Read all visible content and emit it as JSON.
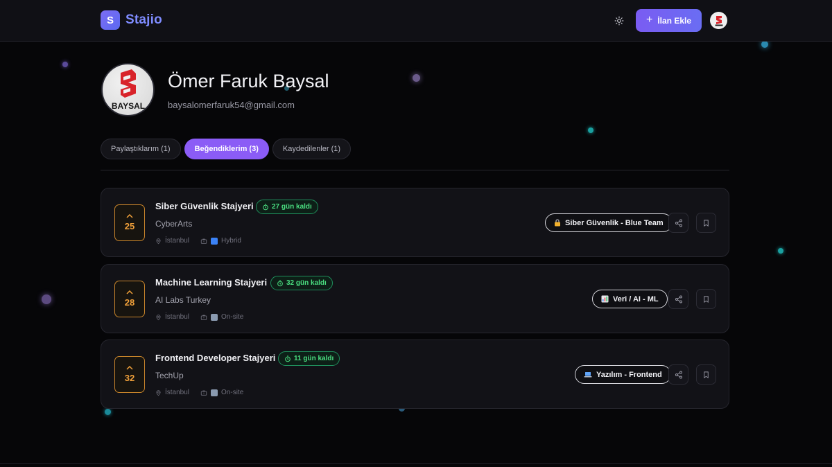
{
  "app": {
    "logo_letter": "S",
    "name": "Stajio"
  },
  "header": {
    "add_label": "İlan Ekle"
  },
  "profile": {
    "name": "Ömer Faruk Baysal",
    "email": "baysalomerfaruk54@gmail.com",
    "avatar_text": "BAYSAL"
  },
  "tabs": [
    {
      "label": "Paylaştıklarım (1)",
      "active": false
    },
    {
      "label": "Beğendiklerim (3)",
      "active": true
    },
    {
      "label": "Kaydedilenler (1)",
      "active": false
    }
  ],
  "listings": [
    {
      "votes": "25",
      "title": "Siber Güvenlik Stajyeri",
      "deadline": "27 gün kaldı",
      "company": "CyberArts",
      "location": "İstanbul",
      "work_type": "Hybrid",
      "category": "Siber Güvenlik - Blue Team",
      "category_icon": "lock-icon"
    },
    {
      "votes": "28",
      "title": "Machine Learning Stajyeri",
      "deadline": "32 gün kaldı",
      "company": "AI Labs Turkey",
      "location": "İstanbul",
      "work_type": "On-site",
      "category": "Veri / AI - ML",
      "category_icon": "chart-icon"
    },
    {
      "votes": "32",
      "title": "Frontend Developer Stajyeri",
      "deadline": "11 gün kaldı",
      "company": "TechUp",
      "location": "İstanbul",
      "work_type": "On-site",
      "category": "Yazılım - Frontend",
      "category_icon": "laptop-icon"
    }
  ],
  "colors": {
    "accent": "#8b5cf6",
    "brand": "#7f8cff",
    "deadline": "#4ade80",
    "vote": "#f0a03a"
  }
}
